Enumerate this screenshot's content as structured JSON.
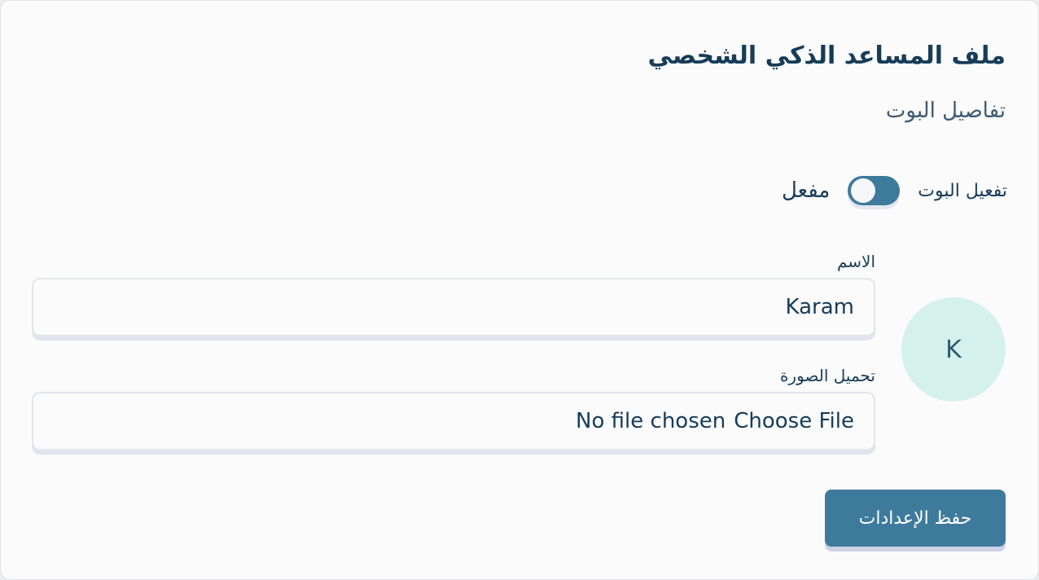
{
  "page": {
    "title": "ملف المساعد الذكي الشخصي",
    "subtitle": "تفاصيل البوت"
  },
  "activation": {
    "label": "تفعيل البوت",
    "status": "مفعل",
    "enabled": true
  },
  "avatar": {
    "initial": "K",
    "background": "#d5f1eb"
  },
  "name_field": {
    "label": "الاسم",
    "value": "Karam"
  },
  "image_upload": {
    "label": "تحميل الصورة",
    "button_label": "Choose File",
    "status": "No file chosen"
  },
  "actions": {
    "save_label": "حفظ الإعدادات"
  },
  "colors": {
    "primary": "#3e7a9c",
    "text": "#163c58",
    "avatar_bg": "#d5f1eb"
  }
}
